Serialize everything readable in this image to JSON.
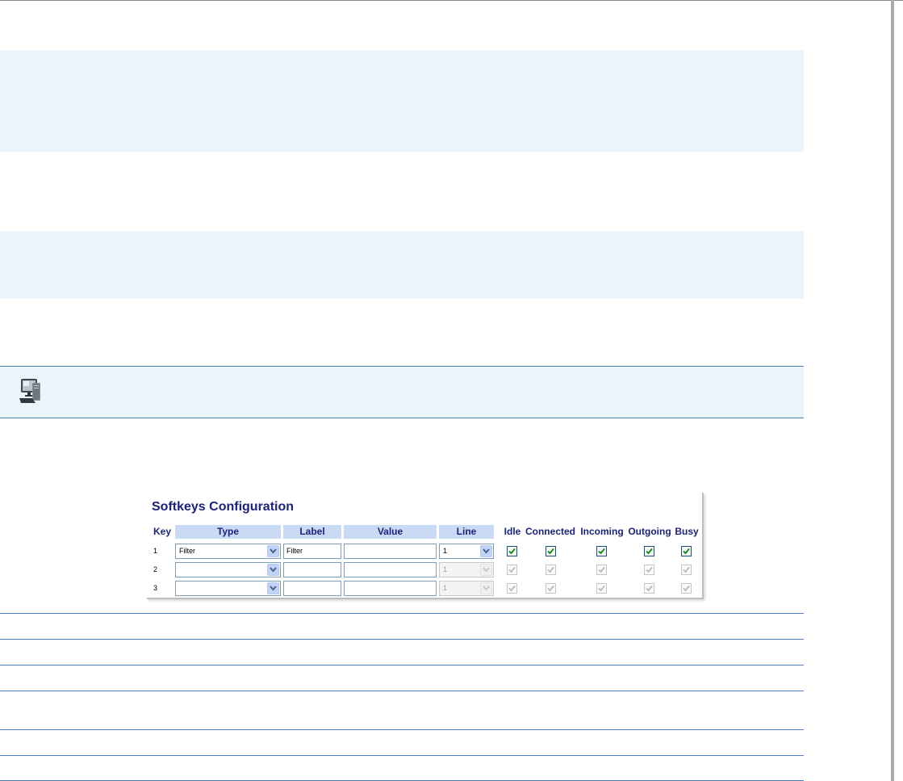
{
  "softkeys": {
    "title": "Softkeys Configuration",
    "columns": [
      "Key",
      "Type",
      "Label",
      "Value",
      "Line",
      "Idle",
      "Connected",
      "Incoming",
      "Outgoing",
      "Busy"
    ],
    "rows": [
      {
        "key": "1",
        "type": "Filter",
        "label": "Filter",
        "value": "",
        "line": "1",
        "line_enabled": true,
        "states": {
          "idle": true,
          "connected": true,
          "incoming": true,
          "outgoing": true,
          "busy": true
        },
        "states_enabled": true
      },
      {
        "key": "2",
        "type": "",
        "label": "",
        "value": "",
        "line": "1",
        "line_enabled": false,
        "states": {
          "idle": true,
          "connected": true,
          "incoming": true,
          "outgoing": true,
          "busy": true
        },
        "states_enabled": false
      },
      {
        "key": "3",
        "type": "",
        "label": "",
        "value": "",
        "line": "1",
        "line_enabled": false,
        "states": {
          "idle": true,
          "connected": true,
          "incoming": true,
          "outgoing": true,
          "busy": true
        },
        "states_enabled": false
      }
    ]
  },
  "icons": {
    "note": "computer-icon"
  },
  "colors": {
    "band": "#ebf3fb",
    "rule": "#4d7eb8",
    "header_bg": "#c9daf4",
    "title": "#1a237e",
    "check": "#0a8a16"
  }
}
